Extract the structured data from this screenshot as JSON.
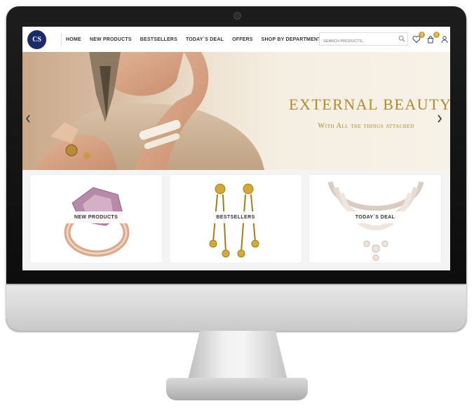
{
  "header": {
    "logo_text": "CS",
    "nav": [
      "HOME",
      "NEW PRODUCTS",
      "BESTSELLERS",
      "TODAY`S DEAL",
      "OFFERS",
      "SHOP BY DEPARTMENT"
    ],
    "search_placeholder": "SEARCH PRODUCTS...",
    "wishlist_count": "0",
    "cart_count": "0"
  },
  "hero": {
    "title": "EXTERNAL BEAUTY",
    "subtitle": "With All the things attached"
  },
  "cards": [
    {
      "label": "NEW PRODUCTS",
      "icon": "ring-image"
    },
    {
      "label": "BESTSELLERS",
      "icon": "earrings-image"
    },
    {
      "label": "TODAY`S DEAL",
      "icon": "necklace-image"
    }
  ],
  "colors": {
    "accent_gold": "#b08a2e",
    "badge_gold": "#c9a33f",
    "logo_navy": "#1b2a6b"
  }
}
